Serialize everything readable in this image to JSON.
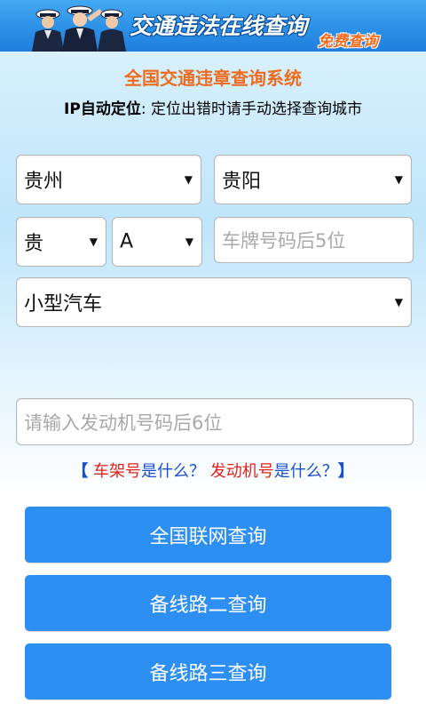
{
  "banner": {
    "title": "交通违法在线查询",
    "badge": "免费查询"
  },
  "header": {
    "system_title": "全国交通违章查询系统",
    "ip_label": "IP自动定位",
    "ip_note": ": 定位出错时请手动选择查询城市"
  },
  "form": {
    "province": "贵州",
    "city": "贵阳",
    "plate_prefix": "贵",
    "plate_letter": "A",
    "plate_placeholder": "车牌号码后5位",
    "vehicle_type": "小型汽车",
    "engine_placeholder": "请输入发动机号码后6位",
    "dropdown_arrow": "▼"
  },
  "help": {
    "open": "【",
    "frame_link": "车架号",
    "frame_text": "是什么？",
    "engine_link": "发动机号",
    "engine_text": "是什么？",
    "close": "】"
  },
  "buttons": {
    "query_national": "全国联网查询",
    "query_backup2": "备线路二查询",
    "query_backup3": "备线路三查询"
  },
  "colors": {
    "banner_blue": "#2b8ee6",
    "title_orange": "#ee6c1f",
    "button_blue": "#2e8ff3",
    "link_red": "#e2231a",
    "link_blue": "#1a4fd1"
  }
}
